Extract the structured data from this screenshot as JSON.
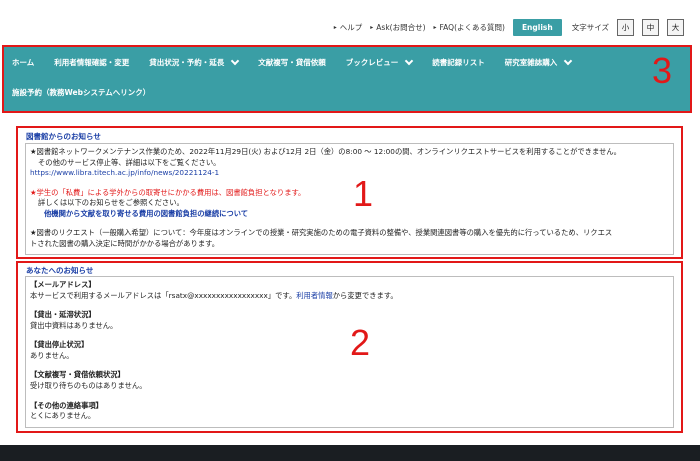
{
  "top_links": {
    "help": "ヘルプ",
    "ask": "Ask(お問合せ)",
    "faq": "FAQ(よくある質問)",
    "english": "English",
    "font_size_label": "文字サイズ",
    "font_small": "小",
    "font_medium": "中",
    "font_large": "大"
  },
  "nav": {
    "items": [
      {
        "label": "ホーム"
      },
      {
        "label": "利用者情報確認・変更"
      },
      {
        "label": "貸出状況・予約・延長"
      },
      {
        "label": "文献複写・貸借依頼"
      },
      {
        "label": "ブックレビュー"
      },
      {
        "label": "読書記録リスト"
      },
      {
        "label": "研究室雑誌購入"
      }
    ],
    "row2_item": "施設予約（教務Webシステムへリンク）",
    "annotation": "3"
  },
  "library_notice": {
    "title": "図書館からのお知らせ",
    "line1": "★図書館ネットワークメンテナンス作業のため、2022年11月29日(火) および12月 2日（金）の8:00 ～ 12:00の間、オンラインリクエストサービスを利用することができません。",
    "line2": "その他のサービス停止等、詳細は以下をご覧ください。",
    "url": "https://www.libra.titech.ac.jp/info/news/20221124-1",
    "line3": "★学生の「私費」による学外からの取寄せにかかる費用は、図書館負担となります。",
    "line4": "詳しくは以下のお知らせをご参照ください。",
    "link2": "他機関から文献を取り寄せる費用の図書館負担の継続について",
    "line5a": "★図書のリクエスト（一般購入希望）について：今年度はオンラインでの授業・研究実施のための電子資料の整備や、授業関連図書等の購入を優先的に行っているため、リクエス",
    "line5b": "トされた図書の購入決定に時間がかかる場合があります。",
    "annotation": "1"
  },
  "user_notice": {
    "title": "あなたへのお知らせ",
    "mail_heading": "【メールアドレス】",
    "mail_text_pre": "本サービスで利用するメールアドレスは「rsatx@xxxxxxxxxxxxxxxxx」です。",
    "mail_link": "利用者情報",
    "mail_text_post": "から変更できます。",
    "loan_heading": "【貸出・延滞状況】",
    "loan_text": "貸出中資料はありません。",
    "suspend_heading": "【貸出停止状況】",
    "suspend_text": "ありません。",
    "ill_heading": "【文献複写・貸借依頼状況】",
    "ill_text": "受け取り待ちのものはありません。",
    "other_heading": "【その他の連絡事項】",
    "other_text": "とくにありません。",
    "annotation": "2"
  }
}
